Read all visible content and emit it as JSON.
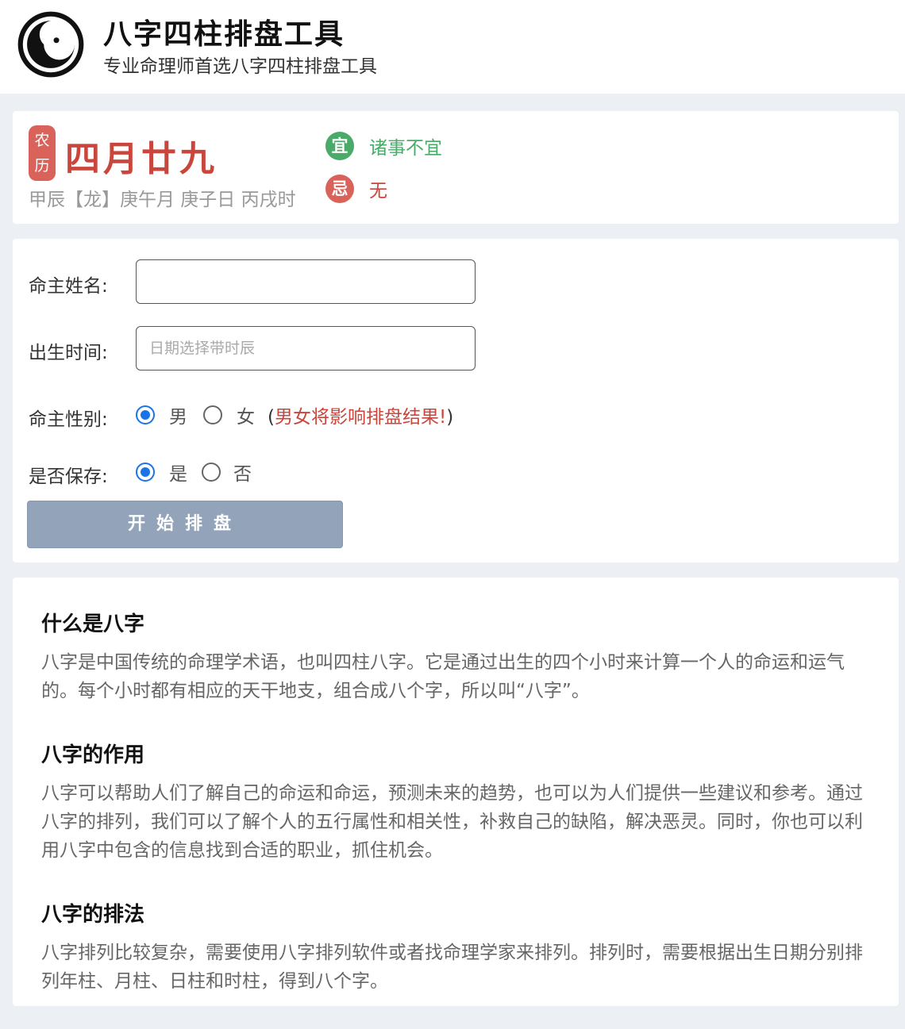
{
  "header": {
    "title": "八字四柱排盘工具",
    "subtitle": "专业命理师首选八字四柱排盘工具"
  },
  "lunar": {
    "badge_top": "农",
    "badge_bottom": "历",
    "date": "四月廿九",
    "ganzhi": "甲辰【龙】庚午月 庚子日 丙戌时",
    "yi_icon": "宜",
    "yi_text": "诸事不宜",
    "ji_icon": "忌",
    "ji_text": "无"
  },
  "form": {
    "name_label": "命主姓名:",
    "name_value": "",
    "birth_label": "出生时间:",
    "birth_placeholder": "日期选择带时辰",
    "gender_label": "命主性别:",
    "gender_options": [
      "男",
      "女"
    ],
    "gender_selected": "男",
    "gender_note_open": "(",
    "gender_note": "男女将影响排盘结果!",
    "gender_note_close": ")",
    "save_label": "是否保存:",
    "save_options": [
      "是",
      "否"
    ],
    "save_selected": "是",
    "submit_label": "开始排盘"
  },
  "article": {
    "sections": [
      {
        "heading": "什么是八字",
        "body": "八字是中国传统的命理学术语，也叫四柱八字。它是通过出生的四个小时来计算一个人的命运和运气的。每个小时都有相应的天干地支，组合成八个字，所以叫“八字”。"
      },
      {
        "heading": "八字的作用",
        "body": "八字可以帮助人们了解自己的命运和命运，预测未来的趋势，也可以为人们提供一些建议和参考。通过八字的排列，我们可以了解个人的五行属性和相关性，补救自己的缺陷，解决恶灵。同时，你也可以利用八字中包含的信息找到合适的职业，抓住机会。"
      },
      {
        "heading": "八字的排法",
        "body": "八字排列比较复杂，需要使用八字排列软件或者找命理学家来排列。排列时，需要根据出生日期分别排列年柱、月柱、日柱和时柱，得到八个字。"
      }
    ]
  },
  "colors": {
    "accent_red": "#c9463c",
    "accent_green": "#4aaa6a",
    "button_bg": "#93a4ba",
    "radio_blue": "#1a73e8"
  },
  "icons": {
    "logo": "yin-yang-logo-icon"
  }
}
